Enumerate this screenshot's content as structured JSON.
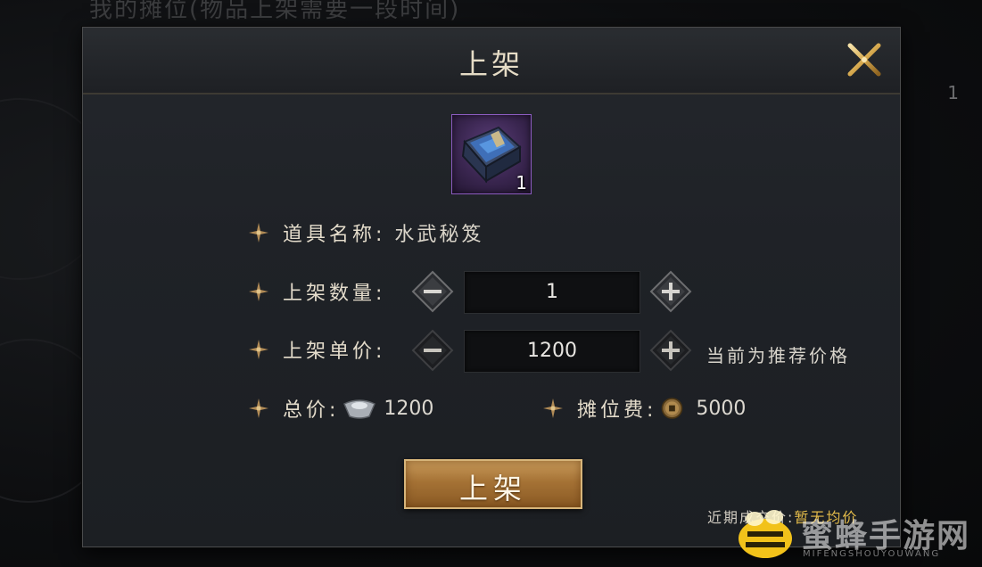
{
  "background": {
    "title": "我的摊位(物品上架需要一段时间)",
    "side_number": "1"
  },
  "dialog": {
    "title": "上架",
    "close_icon": "close-x-icon",
    "item": {
      "icon": "blue-book-icon",
      "count": "1",
      "rarity_color": "#8c5cc0"
    },
    "name_row": {
      "label": "道具名称:",
      "value": "水武秘笈"
    },
    "quantity_row": {
      "label": "上架数量:",
      "value": "1",
      "minus_icon": "minus-icon",
      "plus_icon": "plus-icon"
    },
    "price_row": {
      "label": "上架单价:",
      "value": "1200",
      "minus_icon": "minus-icon",
      "plus_icon": "plus-icon",
      "hint": "当前为推荐价格"
    },
    "total_row": {
      "label": "总价:",
      "currency_icon": "silver-ingot-icon",
      "value": "1200"
    },
    "fee_row": {
      "label": "摊位费:",
      "currency_icon": "copper-coin-icon",
      "value": "5000"
    },
    "submit_label": "上架",
    "recent": {
      "label": "近期成交价:",
      "value": "暂无均价"
    }
  },
  "watermark": {
    "text": "蜜蜂手游网",
    "sub": "MIFENGSHOUYOUWANG"
  },
  "colors": {
    "accent_gold": "#c89a5a",
    "text_light": "#e4dccb",
    "recent_value": "#e3bb4a"
  }
}
